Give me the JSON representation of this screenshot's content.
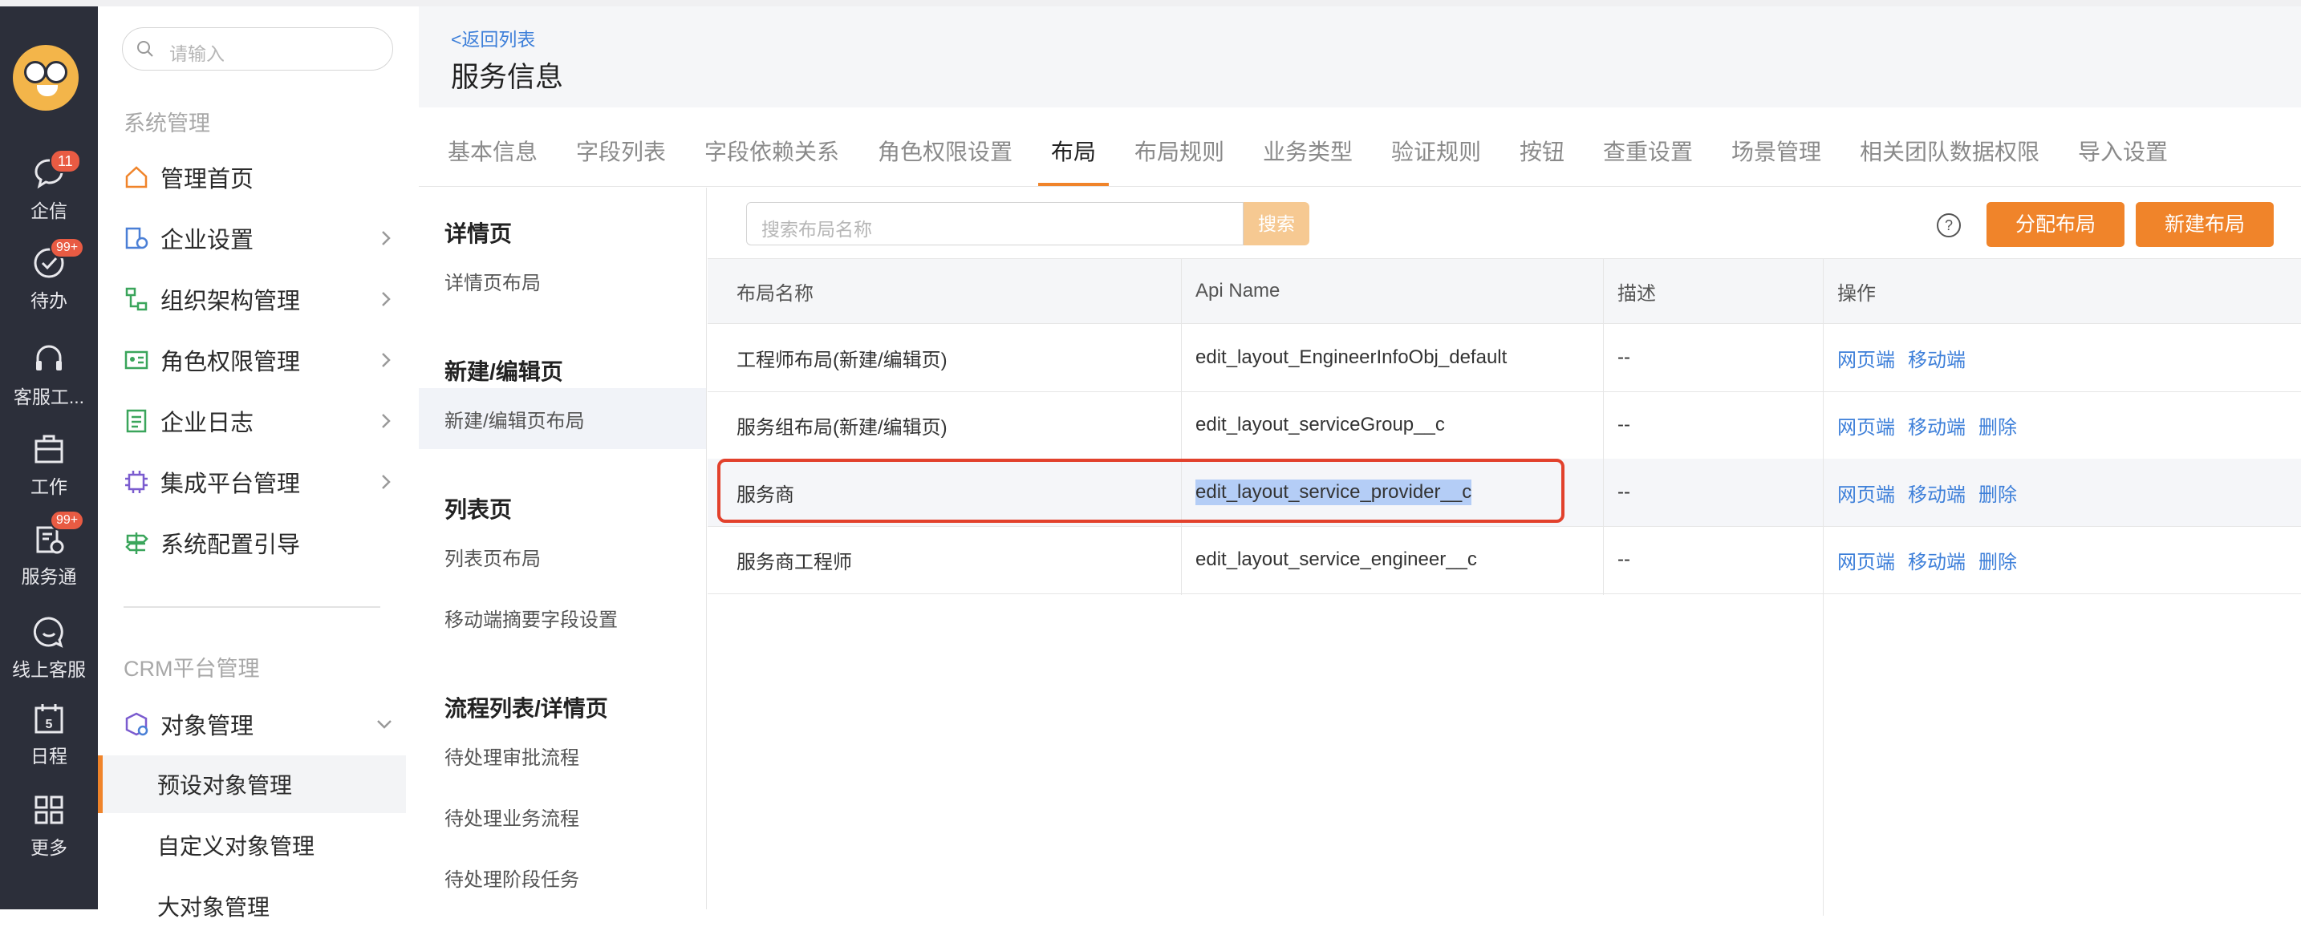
{
  "rail": {
    "items": [
      {
        "label": "企信",
        "badge": "11",
        "icon": "chat-bubble-icon"
      },
      {
        "label": "待办",
        "badge": "99+",
        "icon": "check-circle-icon"
      },
      {
        "label": "客服工...",
        "badge": "",
        "icon": "headset-icon"
      },
      {
        "label": "工作",
        "badge": "",
        "icon": "briefcase-icon"
      },
      {
        "label": "服务通",
        "badge": "99+",
        "icon": "service-clipboard-icon"
      },
      {
        "label": "线上客服",
        "badge": "",
        "icon": "smile-chat-icon"
      },
      {
        "label": "日程",
        "badge": "",
        "icon": "calendar-icon",
        "calendar_day": "5"
      },
      {
        "label": "更多",
        "badge": "",
        "icon": "grid-icon"
      }
    ]
  },
  "nav": {
    "search_placeholder": "请输入",
    "section1": "系统管理",
    "items": [
      {
        "label": "管理首页",
        "icon": "home-icon"
      },
      {
        "label": "企业设置",
        "icon": "building-settings-icon"
      },
      {
        "label": "组织架构管理",
        "icon": "org-chart-icon"
      },
      {
        "label": "角色权限管理",
        "icon": "id-card-icon"
      },
      {
        "label": "企业日志",
        "icon": "log-document-icon"
      },
      {
        "label": "集成平台管理",
        "icon": "chip-icon"
      },
      {
        "label": "系统配置引导",
        "icon": "signpost-icon"
      }
    ],
    "section2": "CRM平台管理",
    "object_mgmt": "对象管理",
    "subs": [
      "预设对象管理",
      "自定义对象管理",
      "大对象管理"
    ]
  },
  "header": {
    "back": "<返回列表",
    "title": "服务信息"
  },
  "tabs": [
    "基本信息",
    "字段列表",
    "字段依赖关系",
    "角色权限设置",
    "布局",
    "布局规则",
    "业务类型",
    "验证规则",
    "按钮",
    "查重设置",
    "场景管理",
    "相关团队数据权限",
    "导入设置"
  ],
  "left_panel": {
    "groups": [
      {
        "title": "详情页",
        "items": [
          "详情页布局"
        ]
      },
      {
        "title": "新建/编辑页",
        "items": [
          "新建/编辑页布局"
        ]
      },
      {
        "title": "列表页",
        "items": [
          "列表页布局",
          "移动端摘要字段设置"
        ]
      },
      {
        "title": "流程列表/详情页",
        "items": [
          "待处理审批流程",
          "待处理业务流程",
          "待处理阶段任务"
        ]
      }
    ]
  },
  "toolbar": {
    "search_placeholder": "搜索布局名称",
    "search_btn": "搜索",
    "help": "?",
    "assign_btn": "分配布局",
    "new_btn": "新建布局"
  },
  "table": {
    "headers": [
      "布局名称",
      "Api Name",
      "描述",
      "操作"
    ],
    "rows": [
      {
        "name": "工程师布局(新建/编辑页)",
        "api": "edit_layout_EngineerInfoObj_default",
        "desc": "--",
        "actions": [
          "网页端",
          "移动端"
        ]
      },
      {
        "name": "服务组布局(新建/编辑页)",
        "api": "edit_layout_serviceGroup__c",
        "desc": "--",
        "actions": [
          "网页端",
          "移动端",
          "删除"
        ]
      },
      {
        "name": "服务商",
        "api": "edit_layout_service_provider__c",
        "desc": "--",
        "actions": [
          "网页端",
          "移动端",
          "删除"
        ]
      },
      {
        "name": "服务商工程师",
        "api": "edit_layout_service_engineer__c",
        "desc": "--",
        "actions": [
          "网页端",
          "移动端",
          "删除"
        ]
      }
    ]
  },
  "colors": {
    "accent": "#f0842a",
    "link": "#3d7fd9",
    "rail": "#2c2f3a",
    "highlight_border": "#e2412c"
  }
}
